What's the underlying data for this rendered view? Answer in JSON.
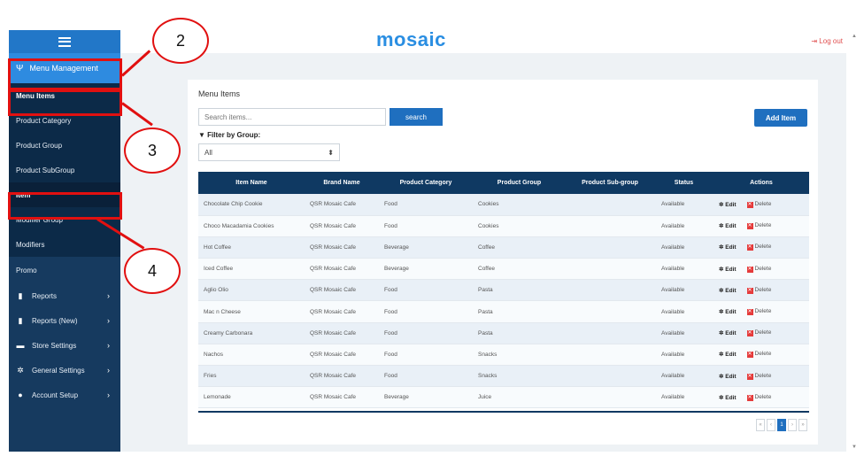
{
  "header": {
    "logo": "mosaic",
    "logout": "Log out"
  },
  "sidebar": {
    "menu_management": "Menu Management",
    "sub_items": [
      "Menu Items",
      "Product Category",
      "Product Group",
      "Product SubGroup",
      "Item",
      "Modifier Group",
      "Modifiers"
    ],
    "promo": "Promo",
    "sections": [
      {
        "label": "Reports",
        "icon": "file-icon"
      },
      {
        "label": "Reports (New)",
        "icon": "file-icon"
      },
      {
        "label": "Store Settings",
        "icon": "card-icon"
      },
      {
        "label": "General Settings",
        "icon": "gear-icon"
      },
      {
        "label": "Account Setup",
        "icon": "user-icon"
      }
    ]
  },
  "annotations": {
    "c2": "2",
    "c3": "3",
    "c4": "4",
    "color": "#e11010"
  },
  "main": {
    "title": "Menu Items",
    "search_placeholder": "Search items...",
    "search_label": "search",
    "add_label": "Add Item",
    "filter_label": "Filter by Group:",
    "filter_value": "All",
    "columns": [
      "Item Name",
      "Brand Name",
      "Product Category",
      "Product Group",
      "Product Sub-group",
      "Status",
      "Actions"
    ],
    "edit_label": "Edit",
    "delete_label": "Delete",
    "rows": [
      [
        "Chocolate Chip Cookie",
        "QSR Mosaic Cafe",
        "Food",
        "Cookies",
        "",
        "Available"
      ],
      [
        "Choco Macadamia Cookies",
        "QSR Mosaic Cafe",
        "Food",
        "Cookies",
        "",
        "Available"
      ],
      [
        "Hot Coffee",
        "QSR Mosaic Cafe",
        "Beverage",
        "Coffee",
        "",
        "Available"
      ],
      [
        "Iced Coffee",
        "QSR Mosaic Cafe",
        "Beverage",
        "Coffee",
        "",
        "Available"
      ],
      [
        "Aglio Olio",
        "QSR Mosaic Cafe",
        "Food",
        "Pasta",
        "",
        "Available"
      ],
      [
        "Mac n Cheese",
        "QSR Mosaic Cafe",
        "Food",
        "Pasta",
        "",
        "Available"
      ],
      [
        "Creamy Carbonara",
        "QSR Mosaic Cafe",
        "Food",
        "Pasta",
        "",
        "Available"
      ],
      [
        "Nachos",
        "QSR Mosaic Cafe",
        "Food",
        "Snacks",
        "",
        "Available"
      ],
      [
        "Fries",
        "QSR Mosaic Cafe",
        "Food",
        "Snacks",
        "",
        "Available"
      ],
      [
        "Lemonade",
        "QSR Mosaic Cafe",
        "Beverage",
        "Juice",
        "",
        "Available"
      ]
    ],
    "pager": [
      "«",
      "‹",
      "1",
      "›",
      "»"
    ]
  }
}
